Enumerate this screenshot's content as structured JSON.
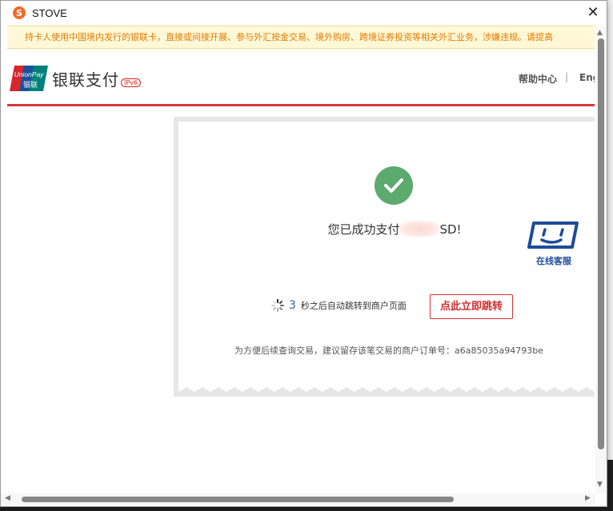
{
  "window": {
    "app_icon": "S",
    "title": "STOVE",
    "close": "✕"
  },
  "notice": "持卡人使用中国境内发行的银联卡，直接或间接开展、参与外汇按金交易、境外购房、跨境证券投资等相关外汇业务，涉嫌违规。请提高",
  "header": {
    "logo_top": "UnionPay",
    "logo_bottom": "银联",
    "brand": "银联支付",
    "ipv6": "IPv6",
    "help": "帮助中心",
    "separator": "|",
    "lang": "Eng"
  },
  "main": {
    "success_prefix": "您已成功支付",
    "success_suffix": "SD!",
    "customer_service": "在线客服",
    "countdown_value": "3",
    "countdown_text": "秒之后自动跳转到商户页面",
    "jump_button": "点此立即跳转",
    "order_info": "为方便后续查询交易，建议留存该笔交易的商户订单号：a6a85035a94793be"
  },
  "colors": {
    "accent_red": "#d5393a",
    "success_green": "#5caa6e",
    "notice_text": "#e07b00",
    "service_blue": "#1d4b9a"
  },
  "icons": [
    "stove-app-icon",
    "close-icon",
    "unionpay-logo",
    "check-icon",
    "customer-service-icon",
    "loading-spinner-icon"
  ]
}
